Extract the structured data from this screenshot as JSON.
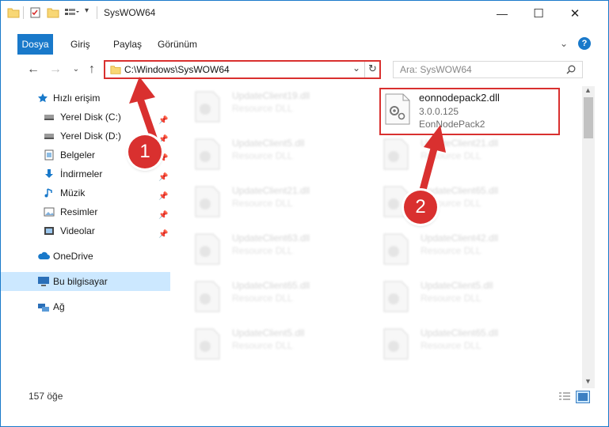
{
  "window": {
    "title": "SysWOW64",
    "controls": {
      "minimize": "—",
      "maximize": "☐",
      "close": "✕"
    }
  },
  "ribbon": {
    "tabs": [
      "Dosya",
      "Giriş",
      "Paylaş",
      "Görünüm"
    ],
    "collapse_icon": "chevron-up-icon",
    "help_icon": "help-icon"
  },
  "navbar": {
    "address": "C:\\Windows\\SysWOW64",
    "search_placeholder": "Ara: SysWOW64"
  },
  "sidebar": {
    "items": [
      {
        "label": "Hızlı erişim",
        "icon": "star-icon",
        "pinned": false
      },
      {
        "label": "Yerel Disk (C:)",
        "icon": "drive-icon",
        "pinned": true
      },
      {
        "label": "Yerel Disk (D:)",
        "icon": "drive-icon",
        "pinned": true
      },
      {
        "label": "Belgeler",
        "icon": "documents-icon",
        "pinned": true
      },
      {
        "label": "İndirmeler",
        "icon": "download-icon",
        "pinned": true
      },
      {
        "label": "Müzik",
        "icon": "music-icon",
        "pinned": true
      },
      {
        "label": "Resimler",
        "icon": "pictures-icon",
        "pinned": true
      },
      {
        "label": "Videolar",
        "icon": "videos-icon",
        "pinned": true
      },
      {
        "label": "OneDrive",
        "icon": "cloud-icon",
        "pinned": false
      },
      {
        "label": "Bu bilgisayar",
        "icon": "computer-icon",
        "pinned": false,
        "selected": true
      },
      {
        "label": "Ağ",
        "icon": "network-icon",
        "pinned": false
      }
    ]
  },
  "files": {
    "highlighted": {
      "name": "eonnodepack2.dll",
      "version": "3.0.0.125",
      "description": "EonNodePack2"
    },
    "left_column": [
      {
        "name": "UpdateClient19.dll",
        "desc": "Resource DLL"
      },
      {
        "name": "UpdateClient5.dll",
        "desc": "Resource DLL"
      },
      {
        "name": "UpdateClient21.dll",
        "desc": "Resource DLL"
      },
      {
        "name": "UpdateClient63.dll",
        "desc": "Resource DLL"
      },
      {
        "name": "UpdateClient65.dll",
        "desc": "Resource DLL"
      },
      {
        "name": "UpdateClient5.dll",
        "desc": "Resource DLL"
      }
    ],
    "right_column": [
      {
        "name": "UpdateClient21.dll",
        "desc": "Resource DLL"
      },
      {
        "name": "UpdateClient65.dll",
        "desc": "Resource DLL"
      },
      {
        "name": "UpdateClient42.dll",
        "desc": "Resource DLL"
      },
      {
        "name": "UpdateClient5.dll",
        "desc": "Resource DLL"
      },
      {
        "name": "UpdateClient65.dll",
        "desc": "Resource DLL"
      }
    ]
  },
  "status": {
    "count": "157 öğe"
  },
  "annotations": {
    "step1": "1",
    "step2": "2",
    "color": "#d9302f"
  }
}
